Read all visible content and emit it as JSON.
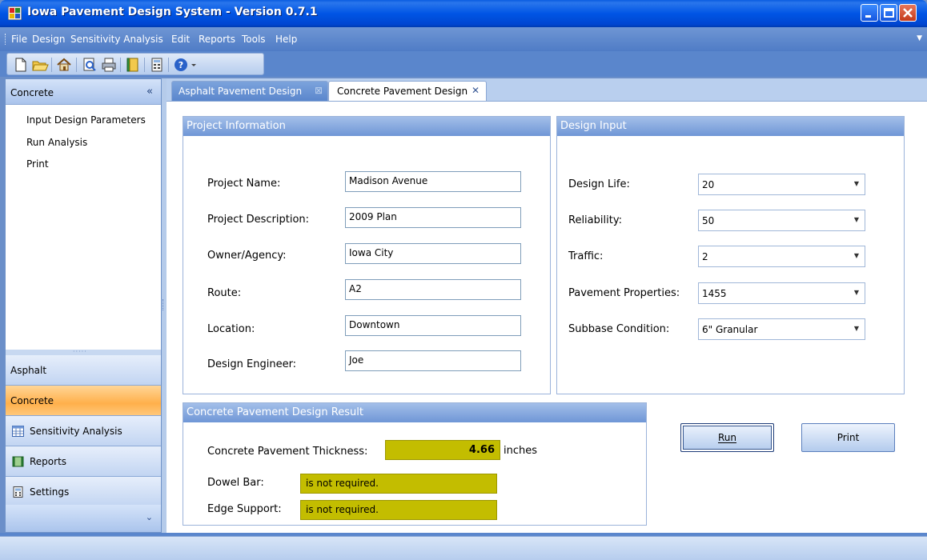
{
  "window": {
    "title": "Iowa Pavement Design System - Version 0.7.1"
  },
  "menu": [
    "File",
    "Design",
    "Sensitivity Analysis",
    "Edit",
    "Reports",
    "Tools",
    "Help"
  ],
  "toolbar": {
    "icons": [
      "new-icon",
      "open-icon",
      "home-icon",
      "print-preview-icon",
      "print-icon",
      "book-icon",
      "calculator-icon",
      "help-icon"
    ]
  },
  "sidebar": {
    "header": "Concrete",
    "collapse_glyph": "«",
    "links": [
      "Input Design Parameters",
      "Run Analysis",
      "Print"
    ],
    "nav": {
      "asphalt": "Asphalt",
      "concrete": "Concrete",
      "sensitivity": "Sensitivity Analysis",
      "reports": "Reports",
      "settings": "Settings"
    },
    "expand_glyph": "⌄"
  },
  "tabs": [
    {
      "label": "Asphalt Pavement Design",
      "active": false
    },
    {
      "label": "Concrete Pavement Design",
      "active": true
    }
  ],
  "project_info": {
    "title": "Project Information",
    "fields": [
      {
        "label": "Project Name:",
        "value": "Madison Avenue"
      },
      {
        "label": "Project Description:",
        "value": "2009 Plan"
      },
      {
        "label": "Owner/Agency:",
        "value": "Iowa City"
      },
      {
        "label": "Route:",
        "value": "A2"
      },
      {
        "label": "Location:",
        "value": "Downtown"
      },
      {
        "label": "Design Engineer:",
        "value": "Joe"
      }
    ]
  },
  "design_input": {
    "title": "Design Input",
    "fields": [
      {
        "label": "Design Life:",
        "value": "20"
      },
      {
        "label": "Reliability:",
        "value": "50"
      },
      {
        "label": "Traffic:",
        "value": "2"
      },
      {
        "label": "Pavement Properties:",
        "value": "1455"
      },
      {
        "label": "Subbase Condition:",
        "value": "6\" Granular"
      }
    ]
  },
  "result": {
    "title": "Concrete Pavement Design Result",
    "thickness_label": "Concrete Pavement Thickness:",
    "thickness_value": "4.66",
    "thickness_unit": "inches",
    "dowel_label": "Dowel Bar:",
    "dowel_value": "is not required.",
    "edge_label": "Edge Support:",
    "edge_value": "is not required."
  },
  "buttons": {
    "run": "Run",
    "print": "Print"
  },
  "colors": {
    "result_highlight": "#c3bd00",
    "active_nav": "#ffb04b",
    "group_header": "#6f96d6"
  }
}
